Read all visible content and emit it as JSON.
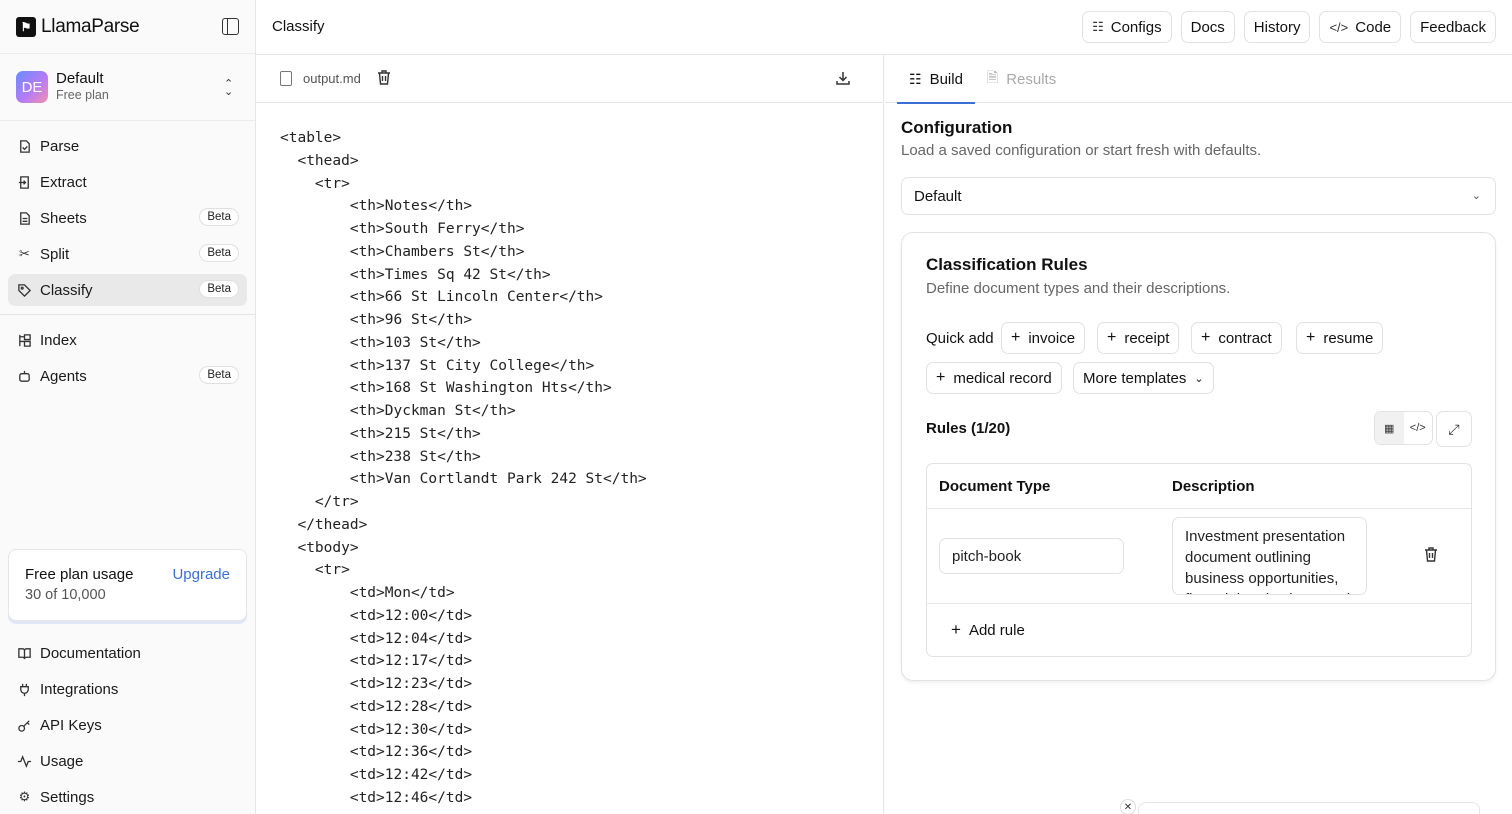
{
  "brand": {
    "name": "LlamaParse"
  },
  "workspace": {
    "initials": "DE",
    "name": "Default",
    "plan": "Free plan"
  },
  "nav": [
    {
      "label": "Parse",
      "icon": "parse-icon",
      "badge": ""
    },
    {
      "label": "Extract",
      "icon": "extract-icon",
      "badge": ""
    },
    {
      "label": "Sheets",
      "icon": "sheets-icon",
      "badge": "Beta"
    },
    {
      "label": "Split",
      "icon": "scissors-icon",
      "badge": "Beta"
    },
    {
      "label": "Classify",
      "icon": "tag-icon",
      "badge": "Beta",
      "active": true
    }
  ],
  "nav2": [
    {
      "label": "Index",
      "icon": "index-icon",
      "badge": ""
    },
    {
      "label": "Agents",
      "icon": "bot-icon",
      "badge": "Beta"
    }
  ],
  "usage": {
    "title": "Free plan usage",
    "count": "30 of 10,000",
    "upgrade": "Upgrade"
  },
  "bottom_nav": [
    {
      "label": "Documentation",
      "icon": "book-icon"
    },
    {
      "label": "Integrations",
      "icon": "plug-icon"
    },
    {
      "label": "API Keys",
      "icon": "key-icon"
    },
    {
      "label": "Usage",
      "icon": "activity-icon"
    },
    {
      "label": "Settings",
      "icon": "gear-icon"
    }
  ],
  "topbar": {
    "title": "Classify",
    "actions": [
      {
        "label": "Configs",
        "icon": "sliders-icon"
      },
      {
        "label": "Docs",
        "icon": ""
      },
      {
        "label": "History",
        "icon": ""
      },
      {
        "label": "Code",
        "icon": "code-icon"
      },
      {
        "label": "Feedback",
        "icon": ""
      }
    ]
  },
  "editor": {
    "file_name": "output.md",
    "code": "<table>\n  <thead>\n    <tr>\n        <th>Notes</th>\n        <th>South Ferry</th>\n        <th>Chambers St</th>\n        <th>Times Sq 42 St</th>\n        <th>66 St Lincoln Center</th>\n        <th>96 St</th>\n        <th>103 St</th>\n        <th>137 St City College</th>\n        <th>168 St Washington Hts</th>\n        <th>Dyckman St</th>\n        <th>215 St</th>\n        <th>238 St</th>\n        <th>Van Cortlandt Park 242 St</th>\n    </tr>\n  </thead>\n  <tbody>\n    <tr>\n        <td>Mon</td>\n        <td>12:00</td>\n        <td>12:04</td>\n        <td>12:17</td>\n        <td>12:23</td>\n        <td>12:28</td>\n        <td>12:30</td>\n        <td>12:36</td>\n        <td>12:42</td>\n        <td>12:46</td>"
  },
  "tabs": [
    {
      "label": "Build",
      "active": true
    },
    {
      "label": "Results",
      "active": false
    }
  ],
  "config": {
    "title": "Configuration",
    "subtitle": "Load a saved configuration or start fresh with defaults.",
    "selected": "Default"
  },
  "rules": {
    "title": "Classification Rules",
    "subtitle": "Define document types and their descriptions.",
    "quick_add_label": "Quick add",
    "chips": [
      "invoice",
      "receipt",
      "contract",
      "resume",
      "medical record"
    ],
    "more_templates": "More templates",
    "count_label": "Rules (1/20)",
    "col_type": "Document Type",
    "col_desc": "Description",
    "rows": [
      {
        "type": "pitch-book",
        "description": "Investment presentation document outlining business opportunities, financial projections, and"
      }
    ],
    "add_rule": "Add rule"
  }
}
